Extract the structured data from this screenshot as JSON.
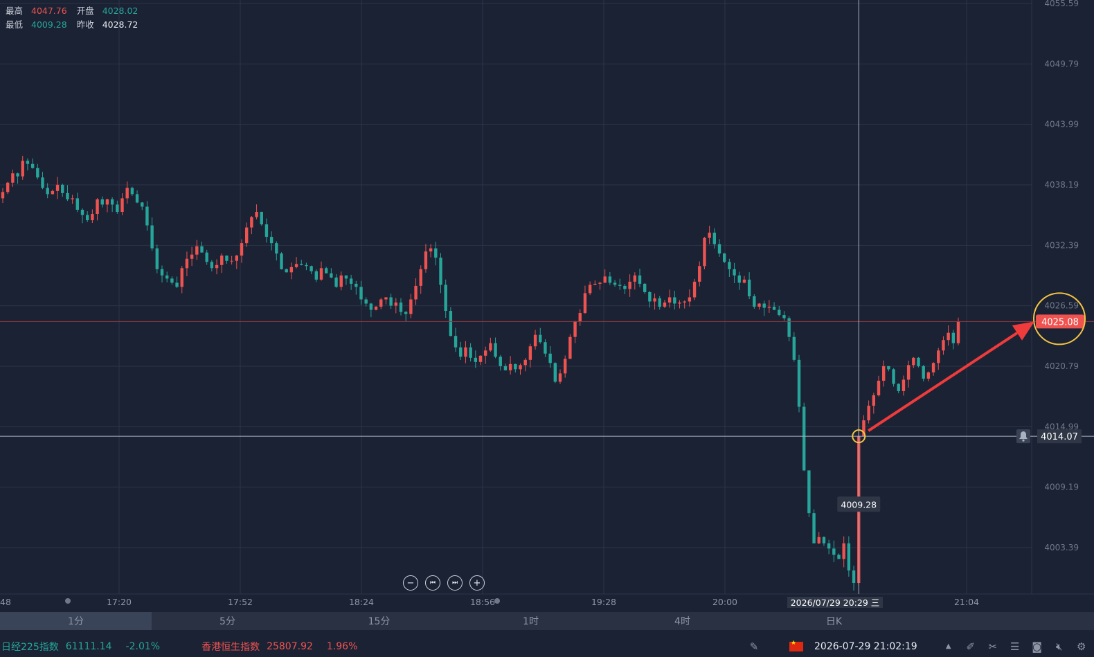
{
  "ohlc": {
    "high_label": "最高",
    "high": "4047.76",
    "open_label": "开盘",
    "open": "4028.02",
    "low_label": "最低",
    "low": "4009.28",
    "prev_close_label": "昨收",
    "prev_close": "4028.72"
  },
  "price_axis": {
    "ticks": [
      "4055.59",
      "4049.79",
      "4043.99",
      "4038.19",
      "4032.39",
      "4026.59",
      "4020.79",
      "4014.99",
      "4009.19",
      "4003.39"
    ],
    "current_price": "4025.08",
    "crosshair_price": "4014.07"
  },
  "time_axis": {
    "ticks": [
      "48",
      "17:20",
      "17:52",
      "18:24",
      "18:56",
      "19:28",
      "20:00",
      "21:04"
    ],
    "crosshair_time": "2026/07/29 20:29 三"
  },
  "low_marker": "4009.28",
  "timeframes": [
    "1分",
    "5分",
    "15分",
    "1时",
    "4时",
    "日K"
  ],
  "active_timeframe": "1分",
  "ticker": [
    {
      "name": "日经225指数",
      "price": "61111.14",
      "change": "-2.01%",
      "dir": "down"
    },
    {
      "name": "香港恒生指数",
      "price": "25807.92",
      "change": "1.96%",
      "dir": "up"
    }
  ],
  "clock": "2026-07-29 21:02:19",
  "colors": {
    "background": "#1b2234",
    "up": "#ef5350",
    "down": "#26a69a",
    "highlight": "#f5c542",
    "arrow": "#ef3b3b"
  },
  "icons": [
    "bell-icon",
    "zoom-out-icon",
    "jump-start-icon",
    "jump-end-icon",
    "zoom-in-icon",
    "draw-icon",
    "flag-icon",
    "chevron-up-icon",
    "edit-icon",
    "tools-icon",
    "list-icon",
    "camera-icon",
    "mute-icon",
    "settings-icon"
  ],
  "chart_data": {
    "type": "candlestick",
    "ylim": [
      4000.5,
      4056.5
    ],
    "yticks": [
      4055.59,
      4049.79,
      4043.99,
      4038.19,
      4032.39,
      4026.59,
      4020.79,
      4014.99,
      4009.19,
      4003.39
    ],
    "xticks": [
      "48",
      "17:20",
      "17:52",
      "18:24",
      "18:56",
      "19:28",
      "20:00",
      "21:04"
    ],
    "close_path": [
      4037.5,
      4038.4,
      4039.3,
      4039.0,
      4040.5,
      4040.2,
      4039.8,
      4038.9,
      4037.9,
      4037.3,
      4037.6,
      4038.2,
      4037.4,
      4036.8,
      4036.9,
      4035.8,
      4035.3,
      4034.8,
      4035.4,
      4036.8,
      4036.3,
      4036.8,
      4036.3,
      4035.6,
      4036.9,
      4037.9,
      4037.3,
      4036.5,
      4036.1,
      4034.3,
      4032.1,
      4030.1,
      4029.5,
      4029.2,
      4028.8,
      4028.4,
      4030.2,
      4031.1,
      4031.5,
      4032.3,
      4031.7,
      4030.8,
      4030.2,
      4030.5,
      4031.4,
      4030.9,
      4030.9,
      4031.4,
      4032.6,
      4034.1,
      4035.1,
      4035.6,
      4034.4,
      4033.2,
      4032.6,
      4031.6,
      4030.1,
      4029.8,
      4030.3,
      4030.6,
      4030.5,
      4030.4,
      4029.9,
      4029.1,
      4030.2,
      4029.7,
      4029.3,
      4028.4,
      4029.5,
      4029.2,
      4028.7,
      4028.4,
      4027.2,
      4026.8,
      4026.2,
      4026.5,
      4027.2,
      4027.4,
      4026.6,
      4026.9,
      4026.0,
      4025.8,
      4027.2,
      4028.5,
      4030.1,
      4031.8,
      4032.1,
      4031.2,
      4028.6,
      4026.1,
      4023.7,
      4022.6,
      4021.7,
      4022.6,
      4021.6,
      4021.2,
      4021.8,
      4022.3,
      4023.0,
      4021.7,
      4020.8,
      4020.4,
      4021.0,
      4020.5,
      4020.9,
      4021.4,
      4022.7,
      4023.8,
      4023.1,
      4022.0,
      4021.1,
      4019.3,
      4020.1,
      4021.5,
      4023.6,
      4025.1,
      4025.9,
      4027.8,
      4028.6,
      4028.7,
      4028.8,
      4029.4,
      4028.8,
      4028.6,
      4028.5,
      4028.2,
      4028.9,
      4029.5,
      4028.7,
      4027.9,
      4027.0,
      4027.3,
      4026.5,
      4026.9,
      4027.4,
      4026.8,
      4026.9,
      4027.0,
      4027.4,
      4028.9,
      4030.4,
      4033.1,
      4033.6,
      4032.5,
      4031.6,
      4030.8,
      4030.1,
      4029.5,
      4028.8,
      4029.1,
      4027.5,
      4026.5,
      4026.8,
      4026.4,
      4026.5,
      4026.2,
      4025.7,
      4025.4,
      4023.6,
      4021.4,
      4016.9,
      4010.8,
      4006.7,
      4003.8,
      4004.4,
      4003.8,
      4003.3,
      4002.7,
      4002.3,
      4003.8,
      4001.2,
      4000.0,
      4014.07,
      4015.6,
      4017.0,
      4018.0,
      4019.4,
      4020.8,
      4020.5,
      4019.1,
      4018.4,
      4019.5,
      4020.9,
      4021.6,
      4020.8,
      4019.6,
      4020.2,
      4021.1,
      4022.3,
      4023.3,
      4024.0,
      4023.0,
      4025.08
    ],
    "low": 4009.28,
    "high": 4047.76,
    "open": 4028.02,
    "prev_close": 4028.72,
    "current": 4025.08,
    "crosshair_price": 4014.07
  }
}
